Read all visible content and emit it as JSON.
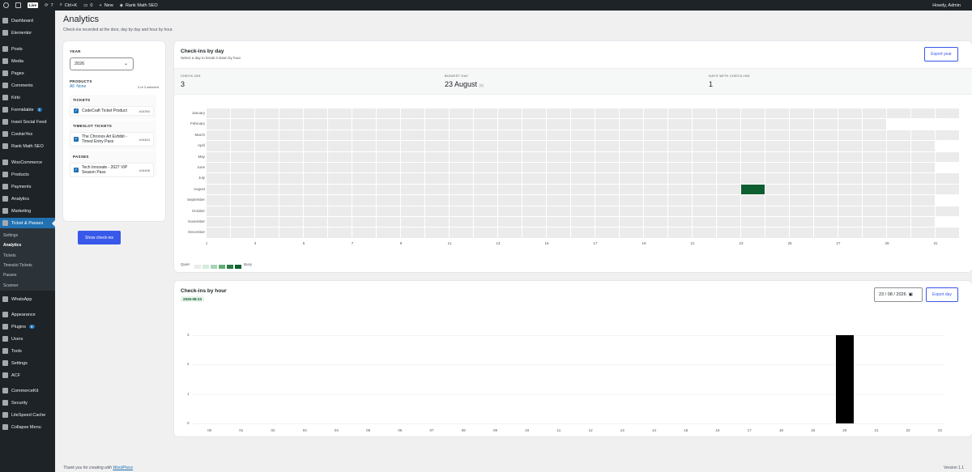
{
  "adminbar": {
    "live": "Live",
    "updates": "7",
    "shortcut": "Ctrl+K",
    "comments": "0",
    "new": "New",
    "seo": "Rank Math SEO",
    "greeting": "Howdy, Admin"
  },
  "menu": [
    {
      "label": "Dashboard",
      "icon": "dashboard-icon"
    },
    {
      "label": "Elementor",
      "icon": "elementor-icon"
    },
    {
      "label": "Posts",
      "icon": "pin-icon"
    },
    {
      "label": "Media",
      "icon": "media-icon"
    },
    {
      "label": "Pages",
      "icon": "page-icon"
    },
    {
      "label": "Comments",
      "icon": "comment-icon"
    },
    {
      "label": "Kirki",
      "icon": "kirki-icon"
    },
    {
      "label": "Formidable",
      "icon": "formidable-icon",
      "badge": "1"
    },
    {
      "label": "Inavii Social Feed",
      "icon": "instagram-icon"
    },
    {
      "label": "CookieYes",
      "icon": "cookie-icon"
    },
    {
      "label": "Rank Math SEO",
      "icon": "chart-icon"
    },
    {
      "label": "WooCommerce",
      "icon": "woo-icon"
    },
    {
      "label": "Products",
      "icon": "archive-icon"
    },
    {
      "label": "Payments",
      "icon": "payment-icon"
    },
    {
      "label": "Analytics",
      "icon": "analytics-icon"
    },
    {
      "label": "Marketing",
      "icon": "megaphone-icon"
    },
    {
      "label": "Ticket & Passes",
      "icon": "ticket-icon",
      "active": true
    },
    {
      "label": "WhatsApp",
      "icon": "whatsapp-icon"
    },
    {
      "label": "Appearance",
      "icon": "brush-icon"
    },
    {
      "label": "Plugins",
      "icon": "plugin-icon",
      "badge": "8"
    },
    {
      "label": "Users",
      "icon": "users-icon"
    },
    {
      "label": "Tools",
      "icon": "wrench-icon"
    },
    {
      "label": "Settings",
      "icon": "settings-icon"
    },
    {
      "label": "ACF",
      "icon": "acf-icon"
    },
    {
      "label": "CommerceKit",
      "icon": "commercekit-icon"
    },
    {
      "label": "Security",
      "icon": "shield-icon"
    },
    {
      "label": "LiteSpeed Cache",
      "icon": "litespeed-icon"
    },
    {
      "label": "Collapse Menu",
      "icon": "collapse-icon"
    }
  ],
  "submenu": [
    {
      "label": "Settings"
    },
    {
      "label": "Analytics",
      "current": true
    },
    {
      "label": "Tickets"
    },
    {
      "label": "Timeslot Tickets"
    },
    {
      "label": "Passes"
    },
    {
      "label": "Scanner"
    }
  ],
  "page": {
    "title": "Analytics",
    "subtitle": "Check-ins recorded at the door, day by day and hour by hour."
  },
  "filters": {
    "year_label": "YEAR",
    "year": "2026",
    "products_label": "PRODUCTS",
    "all": "All",
    "none": "None",
    "selected": "3 of 3 selected",
    "groups": [
      {
        "label": "TICKETS",
        "items": [
          {
            "name": "CodeCraft Ticket Product",
            "id": "#16394"
          }
        ]
      },
      {
        "label": "TIMESLOT TICKETS",
        "items": [
          {
            "name": "The Chronos Art Exhibit - Timed Entry Pass",
            "id": "#16404"
          }
        ]
      },
      {
        "label": "PASSES",
        "items": [
          {
            "name": "Tech Innovate - 2027 VIP Season Pass",
            "id": "#16408"
          }
        ]
      }
    ],
    "button": "Show check-ins"
  },
  "daily": {
    "title": "Check-ins by day",
    "subtitle": "Select a day to break it down by hour.",
    "export": "Export year",
    "stats": [
      {
        "k": "CHECK-INS",
        "v": "3",
        "n": ""
      },
      {
        "k": "BUSIEST DAY",
        "v": "23 August",
        "n": "(3)"
      },
      {
        "k": "DAYS WITH CHECK-INS",
        "v": "1",
        "n": ""
      }
    ],
    "months": [
      "January",
      "February",
      "March",
      "April",
      "May",
      "June",
      "July",
      "August",
      "September",
      "October",
      "November",
      "December"
    ],
    "days_in_month": [
      31,
      28,
      31,
      30,
      31,
      30,
      31,
      31,
      30,
      31,
      30,
      31
    ],
    "day_labels": [
      "1",
      "3",
      "5",
      "7",
      "9",
      "11",
      "13",
      "15",
      "17",
      "19",
      "21",
      "23",
      "25",
      "27",
      "29",
      "31"
    ],
    "highlight": {
      "month": 8,
      "day": 23,
      "value": 3
    },
    "legend": {
      "quiet": "Quiet",
      "busy": "Busy",
      "colors": [
        "#ebebeb",
        "#d6ebdb",
        "#a8d5b5",
        "#5fae78",
        "#2b7a48",
        "#0d5f2f"
      ]
    }
  },
  "hourly": {
    "title": "Check-ins by hour",
    "date_chip": "2026-08-23",
    "date_value": "23 / 08 / 2026",
    "export": "Export day"
  },
  "chart_data": {
    "type": "bar",
    "categories": [
      "00",
      "01",
      "02",
      "03",
      "04",
      "05",
      "06",
      "07",
      "08",
      "09",
      "10",
      "11",
      "12",
      "13",
      "14",
      "15",
      "16",
      "17",
      "18",
      "19",
      "20",
      "21",
      "22",
      "23"
    ],
    "values": [
      0,
      0,
      0,
      0,
      0,
      0,
      0,
      0,
      0,
      0,
      0,
      0,
      0,
      0,
      0,
      0,
      0,
      0,
      0,
      0,
      3,
      0,
      0,
      0
    ],
    "yticks": [
      "0",
      "1",
      "2",
      "3"
    ],
    "ylim": [
      0,
      3
    ],
    "color": "#000000"
  },
  "footer": {
    "text": "Thank you for creating with",
    "link": "WordPress",
    "version": "Version 1.1"
  }
}
